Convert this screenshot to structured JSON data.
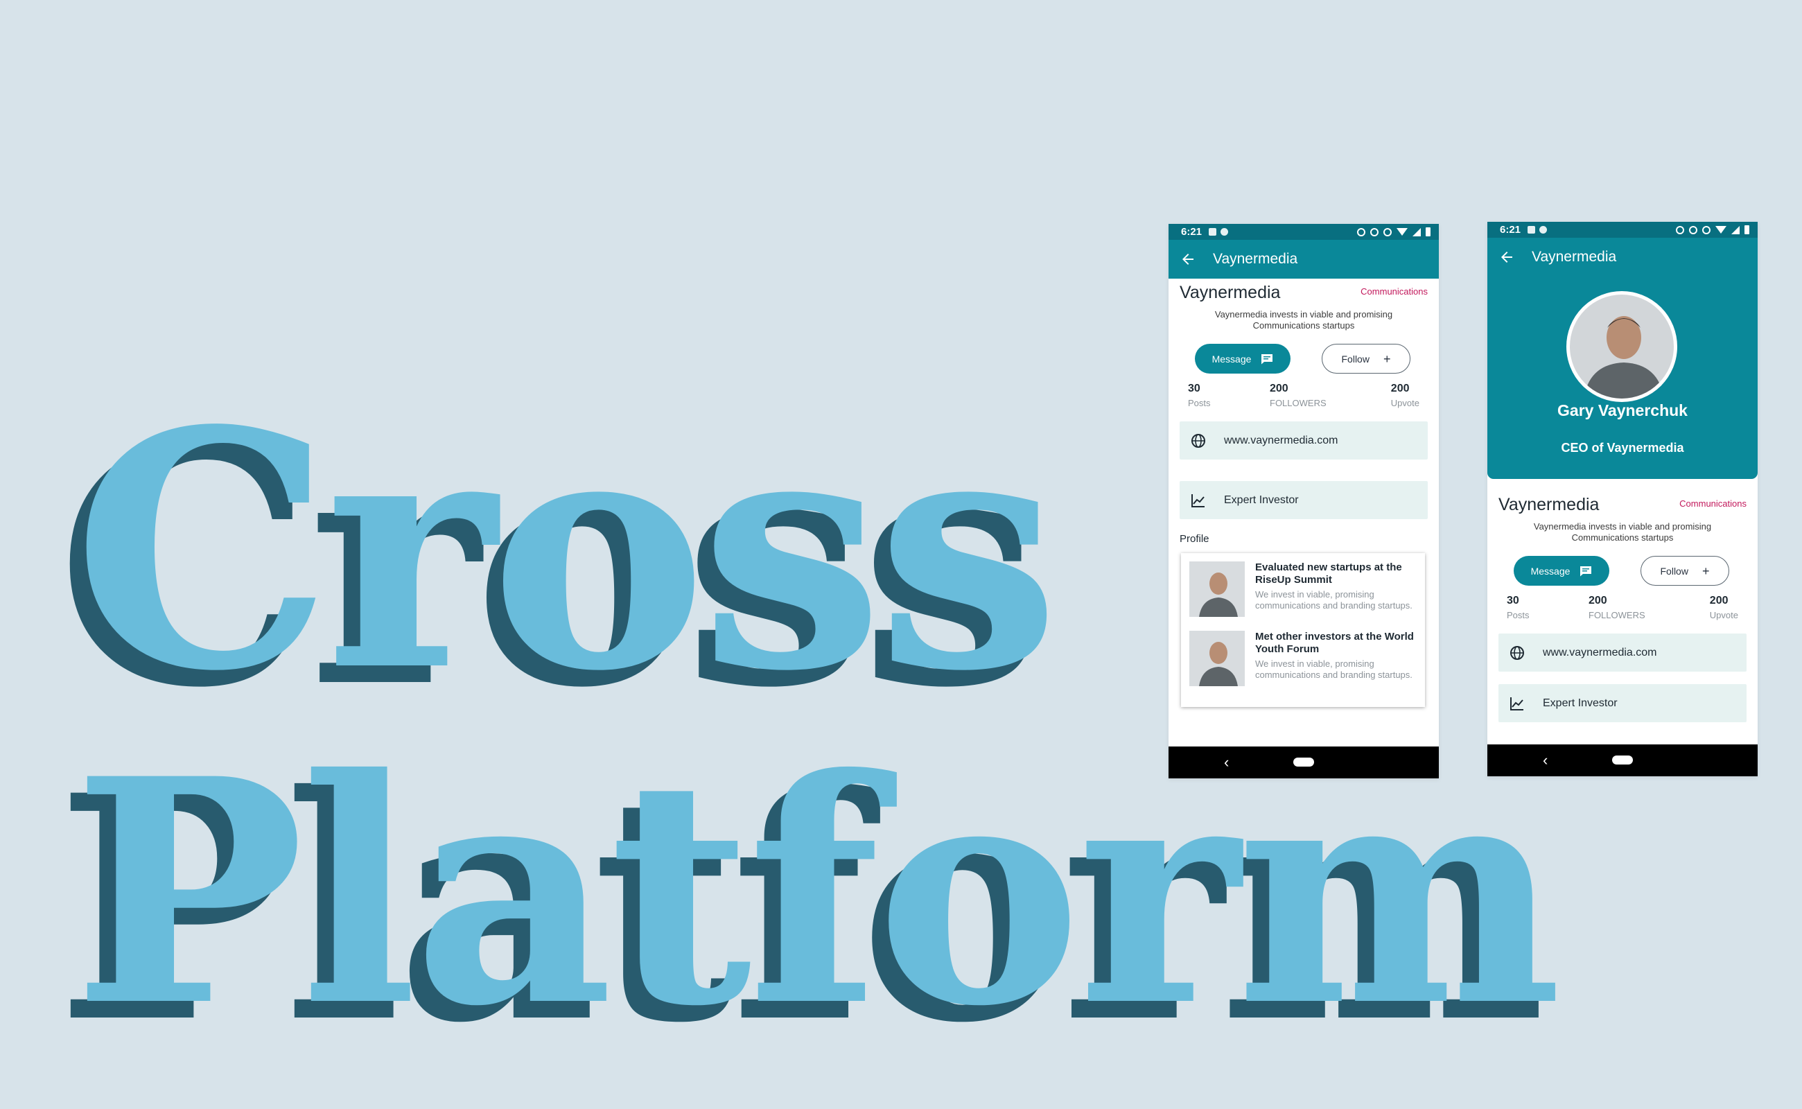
{
  "headline": {
    "line1": "Cross",
    "line2": "Platform"
  },
  "colors": {
    "background": "#d7e3ea",
    "headline_fill": "#69bcdb",
    "headline_shadow": "#285b6e",
    "primary": "#0a8899",
    "status_bar": "#086f80",
    "accent_category": "#c2185b",
    "card_bg": "#e6f2f1"
  },
  "status_bar": {
    "time": "6:21"
  },
  "app_bar": {
    "title": "Vaynermedia"
  },
  "company": {
    "name": "Vaynermedia",
    "category": "Communications",
    "description": "Vaynermedia invests in viable and promising Communications startups"
  },
  "actions": {
    "message_label": "Message",
    "follow_label": "Follow"
  },
  "stats": [
    {
      "value": "30",
      "label": "Posts"
    },
    {
      "value": "200",
      "label": "FOLLOWERS"
    },
    {
      "value": "200",
      "label": "Upvote"
    }
  ],
  "info": {
    "website": "www.vaynermedia.com",
    "role": "Expert Investor"
  },
  "profile_section": {
    "label": "Profile"
  },
  "posts": [
    {
      "title": "Evaluated new startups at the RiseUp Summit",
      "body": "We invest in viable, promising communications and branding startups."
    },
    {
      "title": "Met other investors at the World Youth Forum",
      "body": "We invest in viable, promising communications and branding startups."
    }
  ],
  "person": {
    "name": "Gary Vaynerchuk",
    "title": "CEO of Vaynermedia"
  },
  "icons": {
    "back": "arrow-left-icon",
    "message": "chat-icon",
    "follow": "plus-icon",
    "website": "globe-icon",
    "role": "chart-line-icon",
    "nav_back": "chevron-left-icon",
    "nav_home": "home-pill-icon"
  }
}
